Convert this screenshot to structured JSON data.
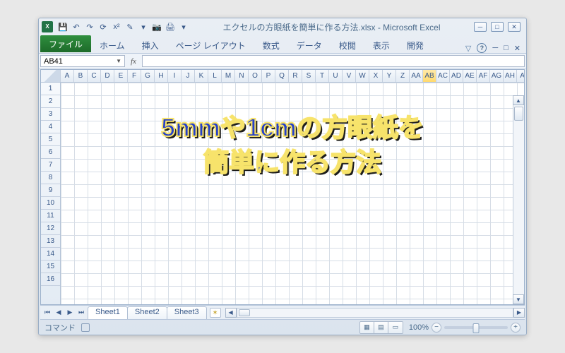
{
  "title": "エクセルの方眼紙を簡単に作る方法.xlsx - Microsoft Excel",
  "ribbon": {
    "file": "ファイル",
    "tabs": [
      "ホーム",
      "挿入",
      "ページ レイアウト",
      "数式",
      "データ",
      "校閲",
      "表示",
      "開発"
    ]
  },
  "namebox": "AB41",
  "formula": "",
  "columns": [
    "A",
    "B",
    "C",
    "D",
    "E",
    "F",
    "G",
    "H",
    "I",
    "J",
    "K",
    "L",
    "M",
    "N",
    "O",
    "P",
    "Q",
    "R",
    "S",
    "T",
    "U",
    "V",
    "W",
    "X",
    "Y",
    "Z",
    "AA",
    "AB",
    "AC",
    "AD",
    "AE",
    "AF",
    "AG",
    "AH",
    "AI"
  ],
  "highlight_col": "AB",
  "rows": [
    "1",
    "2",
    "3",
    "4",
    "5",
    "6",
    "7",
    "8",
    "9",
    "10",
    "11",
    "12",
    "13",
    "14",
    "15",
    "16"
  ],
  "sheets": [
    "Sheet1",
    "Sheet2",
    "Sheet3"
  ],
  "active_sheet": "Sheet1",
  "status": {
    "ready": "コマンド",
    "zoom": "100%"
  },
  "overlay": {
    "line1": "5mmや1cmの方眼紙を",
    "line2": "簡単に作る方法"
  },
  "qat_icons": [
    "save-icon",
    "undo-icon",
    "redo-icon",
    "repeat-icon",
    "superscript-icon",
    "paintbrush-icon",
    "dropdown-icon",
    "camera-icon",
    "print-icon"
  ]
}
